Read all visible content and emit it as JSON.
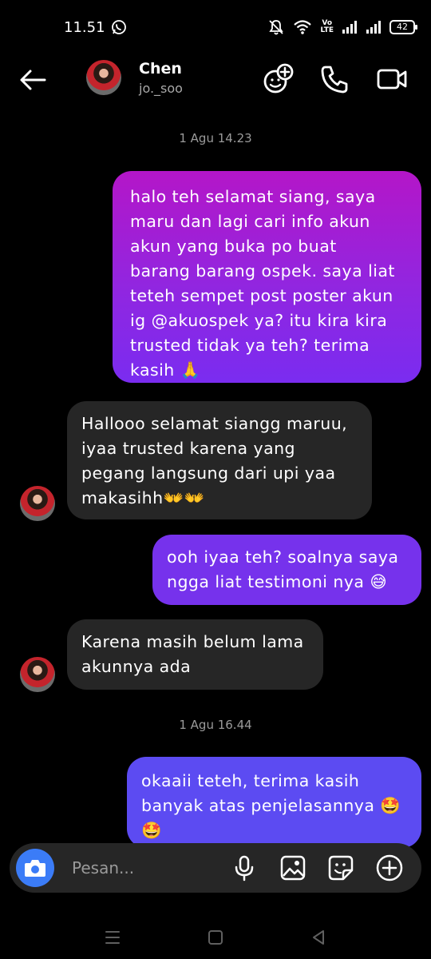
{
  "status_bar": {
    "time": "11.51",
    "volte_top": "Vo",
    "volte_bottom": "LTE",
    "battery": "42",
    "icons": [
      "whatsapp-icon",
      "mute-icon",
      "wifi-icon",
      "volte-icon",
      "signal-icon",
      "signal-icon",
      "battery-icon"
    ]
  },
  "header": {
    "name": "Chen",
    "username": "jo._soo",
    "icons": [
      "back-arrow-icon",
      "add-effect-icon",
      "phone-icon",
      "video-icon"
    ]
  },
  "messages": [
    {
      "type": "timestamp",
      "text": "1 Agu 14.23"
    },
    {
      "type": "sent",
      "text": "halo teh selamat siang, saya\nmaru dan lagi cari info akun\nakun yang buka po buat\nbarang barang ospek. saya liat\nteteh sempet post poster akun\nig @akuospek ya? itu kira kira\ntrusted tidak ya teh? terima\nkasih 🙏"
    },
    {
      "type": "received",
      "text": "Hallooo selamat siangg maruu,\niyaa trusted karena yang\npegang langsung dari upi yaa\nmakasihh👐👐"
    },
    {
      "type": "sent",
      "text": "ooh iyaa teh? soalnya saya\nngga liat testimoni nya 😅"
    },
    {
      "type": "received",
      "text": "Karena masih belum lama\nakunnya ada"
    },
    {
      "type": "timestamp",
      "text": "1 Agu 16.44"
    },
    {
      "type": "sent",
      "text": "okaaii teteh, terima kasih\nbanyak atas penjelasannya 🤩\n🤩"
    }
  ],
  "composer": {
    "placeholder": "Pesan...",
    "icons": [
      "camera-icon",
      "microphone-icon",
      "gallery-icon",
      "sticker-icon",
      "add-icon"
    ]
  },
  "nav_bar": {
    "icons": [
      "recents-icon",
      "home-icon",
      "back-icon"
    ]
  },
  "colors": {
    "background": "#000000",
    "received_bubble": "#262626",
    "sent_gradient_top": "#b416c8",
    "sent_gradient_bottom": "#5c4bf2",
    "camera_button": "#3b7cf7",
    "timestamp": "#9a9a9a"
  }
}
